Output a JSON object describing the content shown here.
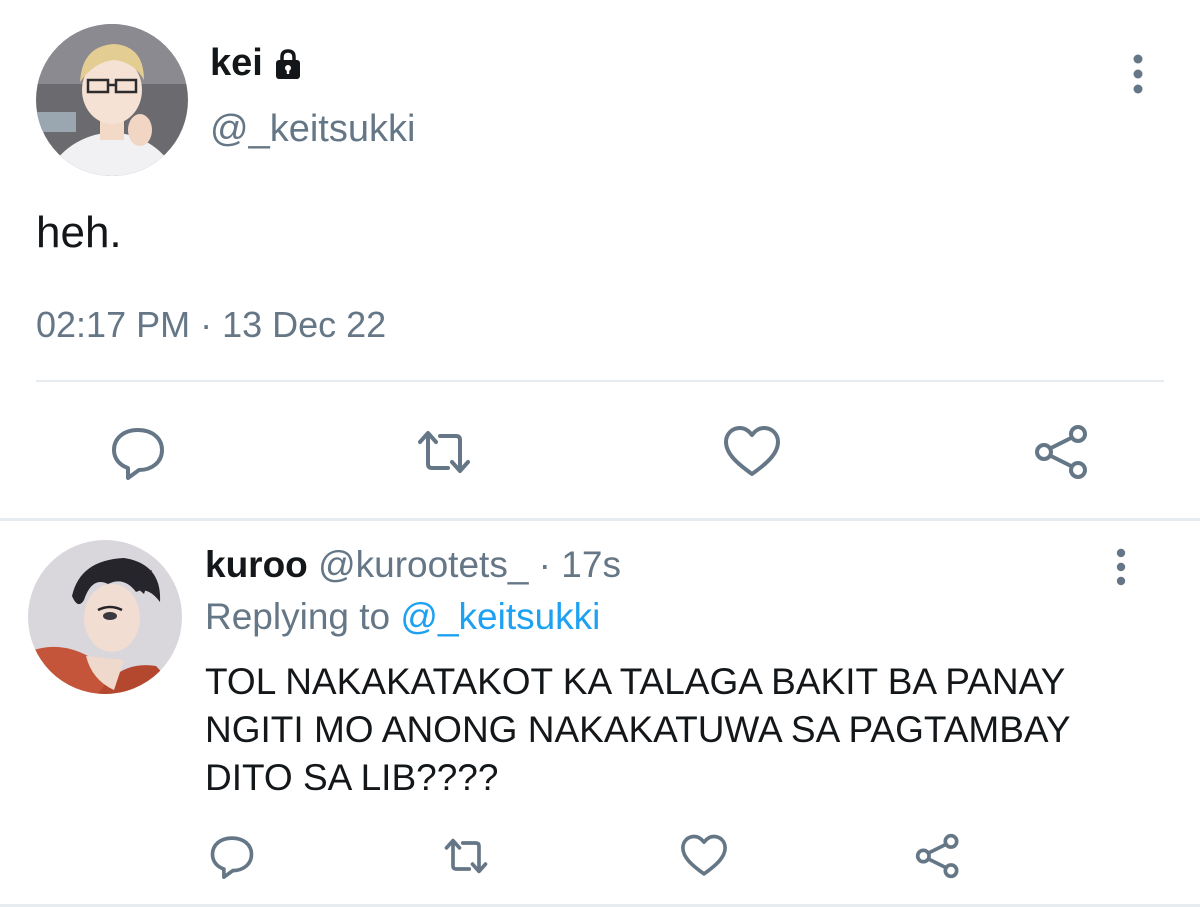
{
  "main_tweet": {
    "display_name": "kei",
    "protected_icon": "lock-icon",
    "handle": "@_keitsukki",
    "text": "heh.",
    "timestamp": "02:17 PM · 13 Dec 22",
    "actions": [
      "reply-icon",
      "retweet-icon",
      "like-icon",
      "share-icon"
    ]
  },
  "reply": {
    "display_name": "kuroo",
    "handle": "@kurootets_",
    "separator": " · ",
    "time": "17s",
    "replying_prefix": "Replying to ",
    "replying_to": "@_keitsukki",
    "text": "TOL NAKAKATAKOT KA TALAGA BAKIT BA PANAY NGITI MO ANONG NAKAKATUWA SA PAGTAMBAY DITO SA LIB????",
    "actions": [
      "reply-icon",
      "retweet-icon",
      "like-icon",
      "share-icon"
    ]
  },
  "colors": {
    "text_primary": "#14171a",
    "text_secondary": "#657786",
    "link": "#1da1f2",
    "divider": "#e6ecf0",
    "icon": "#657786"
  }
}
